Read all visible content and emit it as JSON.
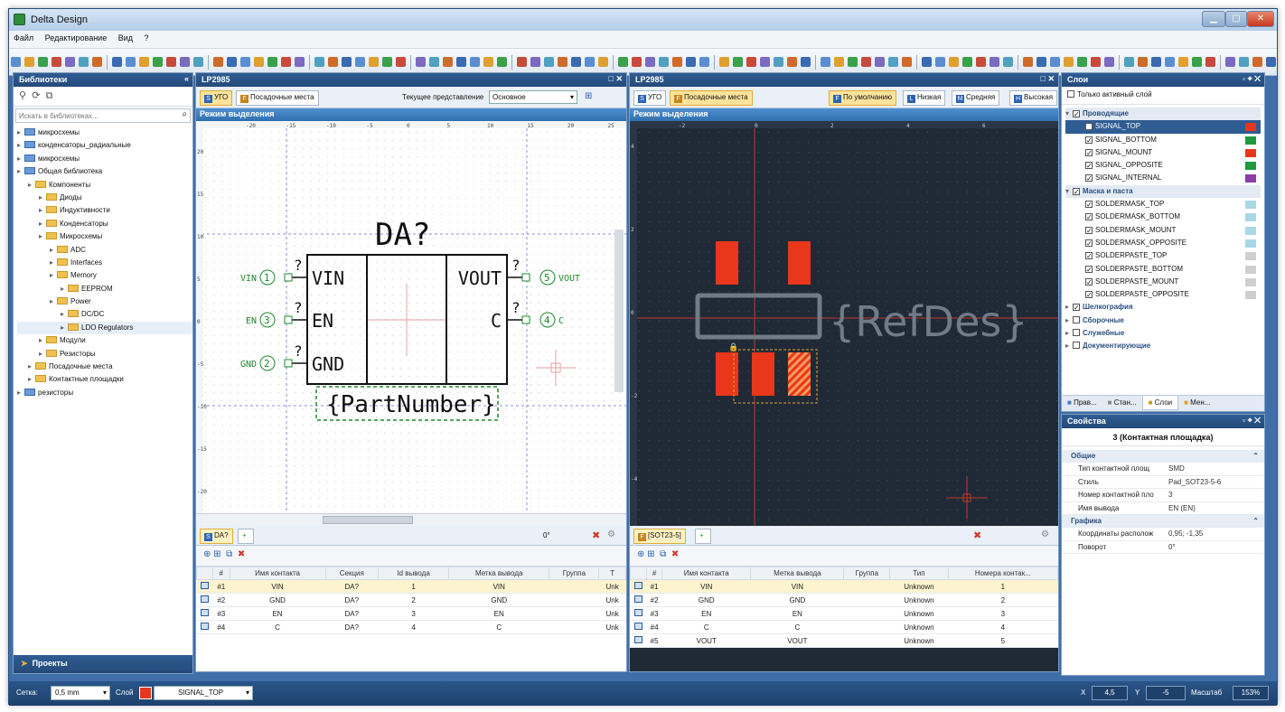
{
  "window": {
    "title": "Delta Design"
  },
  "menu": [
    "Файл",
    "Редактирование",
    "Вид",
    "?"
  ],
  "libraries": {
    "title": "Библиотеки",
    "search_placeholder": "Искать в библиотеках...",
    "tree": [
      {
        "label": "микросхемы",
        "indent": 0,
        "type": "lib"
      },
      {
        "label": "конденсаторы_радиальные",
        "indent": 0,
        "type": "lib"
      },
      {
        "label": "микросхемы",
        "indent": 0,
        "type": "lib"
      },
      {
        "label": "Общая библиотека",
        "indent": 0,
        "type": "lib"
      },
      {
        "label": "Компоненты",
        "indent": 1,
        "type": "folder"
      },
      {
        "label": "Диоды",
        "indent": 2,
        "type": "folder"
      },
      {
        "label": "Индуктивности",
        "indent": 2,
        "type": "folder"
      },
      {
        "label": "Конденсаторы",
        "indent": 2,
        "type": "folder"
      },
      {
        "label": "Микросхемы",
        "indent": 2,
        "type": "folder"
      },
      {
        "label": "ADC",
        "indent": 3,
        "type": "folder"
      },
      {
        "label": "Interfaces",
        "indent": 3,
        "type": "folder"
      },
      {
        "label": "Memory",
        "indent": 3,
        "type": "folder"
      },
      {
        "label": "EEPROM",
        "indent": 4,
        "type": "folder"
      },
      {
        "label": "Power",
        "indent": 3,
        "type": "folder"
      },
      {
        "label": "DC/DC",
        "indent": 4,
        "type": "folder"
      },
      {
        "label": "LDO Regulators",
        "indent": 4,
        "type": "folder",
        "selected": true
      },
      {
        "label": "Модули",
        "indent": 2,
        "type": "folder"
      },
      {
        "label": "Резисторы",
        "indent": 2,
        "type": "folder"
      },
      {
        "label": "Посадочные места",
        "indent": 1,
        "type": "folder"
      },
      {
        "label": "Контактные площадки",
        "indent": 1,
        "type": "folder"
      },
      {
        "label": "резисторы",
        "indent": 0,
        "type": "lib"
      }
    ],
    "projects_label": "Проекты"
  },
  "schematic_doc": {
    "title": "LP2985",
    "tab_ugo": "УГО",
    "tab_footprints": "Посадочные места",
    "view_label": "Текущее представление",
    "view_value": "Основное",
    "mode": "Режим выделения",
    "ruler_x": [
      "-20",
      "-15",
      "-10",
      "-5",
      "0",
      "5",
      "10",
      "15",
      "20",
      "25"
    ],
    "ruler_y": [
      "20",
      "15",
      "10",
      "5",
      "0",
      "-5",
      "-10",
      "-15",
      "-20"
    ],
    "refdes": "DA?",
    "part_number": "{PartNumber}",
    "pins_left": [
      {
        "name": "VIN",
        "num": "1"
      },
      {
        "name": "EN",
        "num": "3"
      },
      {
        "name": "GND",
        "num": "2"
      }
    ],
    "pins_right": [
      {
        "name": "VOUT",
        "num": "5"
      },
      {
        "name": "C",
        "num": "4"
      }
    ],
    "pin_mark": "?",
    "bottom_tab": "DA?",
    "rotation": "0°",
    "table_headers": [
      "#",
      "Имя контакта",
      "Секция",
      "Id вывода",
      "Метка вывода",
      "Группа",
      "Т"
    ],
    "table_rows": [
      [
        "#1",
        "VIN",
        "DA?",
        "1",
        "VIN",
        "",
        "Unk"
      ],
      [
        "#2",
        "GND",
        "DA?",
        "2",
        "GND",
        "",
        "Unk"
      ],
      [
        "#3",
        "EN",
        "DA?",
        "3",
        "EN",
        "",
        "Unk"
      ],
      [
        "#4",
        "C",
        "DA?",
        "4",
        "C",
        "",
        "Unk"
      ]
    ]
  },
  "pcb_doc": {
    "title": "LP2985",
    "tab_ugo": "УГО",
    "tab_footprints": "Посадочные места",
    "quality": [
      "По умолчанию",
      "Низкая",
      "Средняя",
      "Высокая"
    ],
    "mode": "Режим выделения",
    "ruler_x": [
      "-2",
      "0",
      "2",
      "4",
      "6"
    ],
    "ruler_y": [
      "4",
      "2",
      "0",
      "-2",
      "-4"
    ],
    "refdes": "{RefDes}",
    "bottom_tab": "[SOT23-5]",
    "table_headers": [
      "#",
      "Имя контакта",
      "Метка вывода",
      "Группа",
      "Тип",
      "Номера контак..."
    ],
    "table_rows": [
      [
        "#1",
        "VIN",
        "VIN",
        "",
        "Unknown",
        "1"
      ],
      [
        "#2",
        "GND",
        "GND",
        "",
        "Unknown",
        "2"
      ],
      [
        "#3",
        "EN",
        "EN",
        "",
        "Unknown",
        "3"
      ],
      [
        "#4",
        "C",
        "C",
        "",
        "Unknown",
        "4"
      ],
      [
        "#5",
        "VOUT",
        "VOUT",
        "",
        "Unknown",
        "5"
      ]
    ]
  },
  "layers": {
    "title": "Слои",
    "only_active": "Только активный слой",
    "groups": [
      {
        "name": "Проводящие",
        "checked": true,
        "items": [
          {
            "name": "SIGNAL_TOP",
            "color": "#e8371a",
            "selected": true
          },
          {
            "name": "SIGNAL_BOTTOM",
            "color": "#1f9a3d"
          },
          {
            "name": "SIGNAL_MOUNT",
            "color": "#e8371a"
          },
          {
            "name": "SIGNAL_OPPOSITE",
            "color": "#1f9a3d"
          },
          {
            "name": "SIGNAL_INTERNAL",
            "color": "#8b3fa6"
          }
        ]
      },
      {
        "name": "Маска и паста",
        "checked": true,
        "items": [
          {
            "name": "SOLDERMASK_TOP",
            "color": "#a8d8e6"
          },
          {
            "name": "SOLDERMASK_BOTTOM",
            "color": "#a8d8e6"
          },
          {
            "name": "SOLDERMASK_MOUNT",
            "color": "#a8d8e6"
          },
          {
            "name": "SOLDERMASK_OPPOSITE",
            "color": "#a8d8e6"
          },
          {
            "name": "SOLDERPASTE_TOP",
            "color": "#cfcfcf"
          },
          {
            "name": "SOLDERPASTE_BOTTOM",
            "color": "#cfcfcf"
          },
          {
            "name": "SOLDERPASTE_MOUNT",
            "color": "#cfcfcf"
          },
          {
            "name": "SOLDERPASTE_OPPOSITE",
            "color": "#cfcfcf"
          }
        ]
      },
      {
        "name": "Шелкография",
        "checked": true,
        "items": []
      },
      {
        "name": "Сборочные",
        "checked": false,
        "items": []
      },
      {
        "name": "Служебные",
        "checked": false,
        "items": []
      },
      {
        "name": "Документирующие",
        "checked": false,
        "items": []
      }
    ],
    "tabs": [
      "Прав...",
      "Стан...",
      "Слои",
      "Мен..."
    ]
  },
  "properties": {
    "title": "Свойства",
    "object": "3 (Контактная площадка)",
    "group_general": "Общие",
    "rows_general": [
      {
        "k": "Тип контактной площ",
        "v": "SMD"
      },
      {
        "k": "Стиль",
        "v": "Pad_SOT23-5-6"
      },
      {
        "k": "Номер контактной пло",
        "v": "3"
      },
      {
        "k": "Имя вывода",
        "v": "EN (EN)"
      }
    ],
    "group_graphics": "Графика",
    "rows_graphics": [
      {
        "k": "Координаты располож",
        "v": "0,95; -1,35"
      },
      {
        "k": "Поворот",
        "v": "0°"
      }
    ]
  },
  "status": {
    "grid_label": "Сетка:",
    "grid_value": "0,5 mm",
    "layer_label": "Слой",
    "layer_value": "SIGNAL_TOP",
    "layer_color": "#e8371a",
    "x_label": "X",
    "x_value": "4,5",
    "y_label": "Y",
    "y_value": "-5",
    "zoom_label": "Масштаб",
    "zoom_value": "153%"
  }
}
